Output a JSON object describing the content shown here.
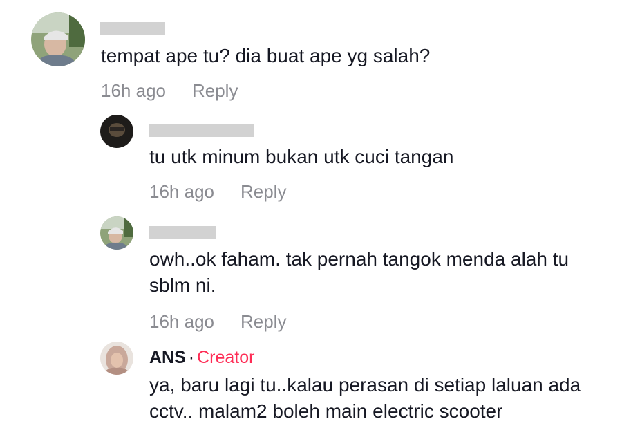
{
  "comments": [
    {
      "username": "",
      "text": "tempat ape tu? dia buat ape yg salah?",
      "time": "16h ago",
      "reply_label": "Reply",
      "avatar": "user-photo-cap"
    },
    {
      "username": "",
      "text": "tu utk minum bukan utk cuci tangan",
      "time": "16h ago",
      "reply_label": "Reply",
      "avatar": "user-photo-dark"
    },
    {
      "username": "",
      "text": "owh..ok faham. tak pernah tangok menda alah tu sblm ni.",
      "time": "16h ago",
      "reply_label": "Reply",
      "avatar": "user-photo-cap"
    },
    {
      "username": "ANS",
      "separator": "·",
      "badge": "Creator",
      "text": "ya, baru lagi tu..kalau perasan di setiap laluan ada cctv.. malam2 boleh main electric scooter",
      "avatar": "user-photo-hijab"
    }
  ],
  "colors": {
    "text": "#161823",
    "muted": "#8a8b91",
    "creator": "#fe2c55",
    "redaction": "#d2d2d2"
  }
}
